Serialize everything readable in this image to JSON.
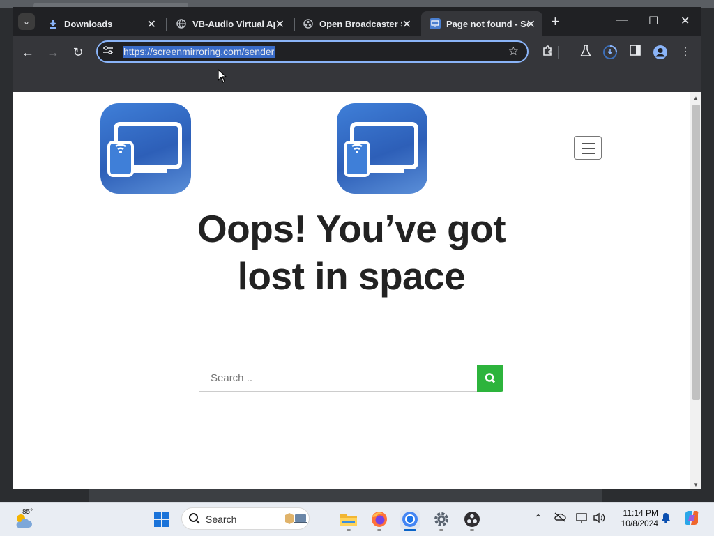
{
  "tabs": [
    {
      "label": "Downloads",
      "favicon": "download-icon",
      "active": false
    },
    {
      "label": "VB-Audio Virtual Ap",
      "favicon": "globe-icon",
      "active": false
    },
    {
      "label": "Open Broadcaster So",
      "favicon": "obs-icon",
      "active": false
    },
    {
      "label": "Page not found - So",
      "favicon": "monitor-icon",
      "active": true
    }
  ],
  "address_bar": {
    "url": "https://screenmirroring.com/sender"
  },
  "page": {
    "headline": "Oops! You’ve got lost in space",
    "search_placeholder": "Search .."
  },
  "taskbar": {
    "weather_temp": "85°",
    "search_label": "Search",
    "time": "11:14 PM",
    "date": "10/8/2024",
    "apps": [
      "start-icon",
      "search-icon",
      "file-explorer-icon",
      "firefox-icon",
      "chrome-icon",
      "settings-icon",
      "obs-icon"
    ]
  },
  "colors": {
    "accent": "#8ab4f8",
    "search_button": "#2db43c",
    "logo_blue": "#3f7fd8"
  }
}
